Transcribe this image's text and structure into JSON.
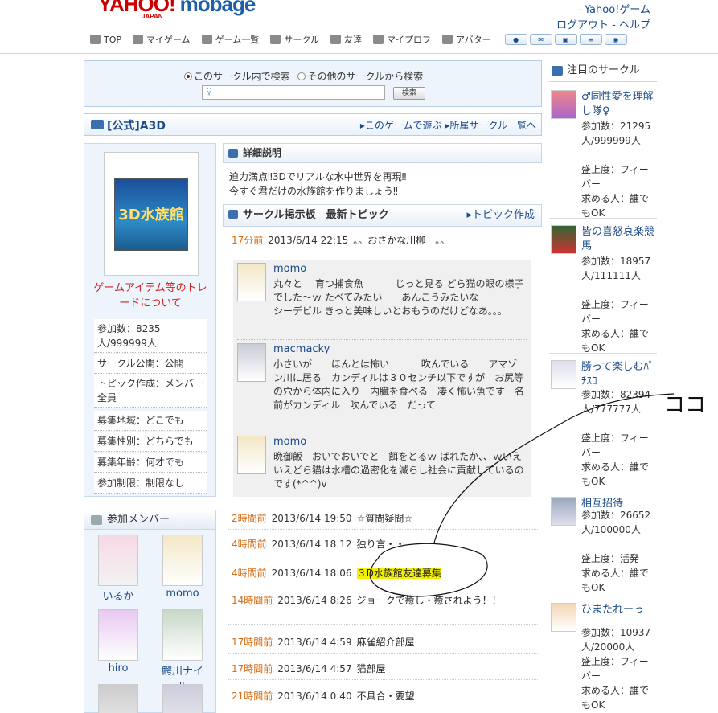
{
  "header": {
    "logo_yahoo": "YAHOO!",
    "logo_japan": "JAPAN",
    "logo_mobage": "mobage",
    "right_links": [
      "- Yahoo!ゲーム",
      "ログアウト - ヘルプ"
    ],
    "nav": [
      {
        "label": "TOP",
        "icon": "home-icon"
      },
      {
        "label": "マイゲーム",
        "icon": "mygame-icon"
      },
      {
        "label": "ゲーム一覧",
        "icon": "gamepad-icon"
      },
      {
        "label": "サークル",
        "icon": "circle-icon"
      },
      {
        "label": "友達",
        "icon": "friends-icon"
      },
      {
        "label": "マイプロフ",
        "icon": "profile-icon"
      },
      {
        "label": "アバター",
        "icon": "avatar-icon"
      }
    ],
    "mini_buttons": [
      "chat-icon",
      "mail-icon",
      "box-icon",
      "list-icon",
      "game-icon"
    ]
  },
  "search": {
    "option_this": "このサークル内で検索",
    "option_other": "その他のサークルから検索",
    "button": "検索",
    "placeholder": ""
  },
  "circle": {
    "title": "[公式]A3D",
    "link_play": "このゲームで遊ぶ",
    "link_list": "所属サークル一覧へ",
    "game_image_text": "3D水族館",
    "trade_link": "ゲームアイテム等のトレードについて",
    "info": [
      "参加数：8235人/999999人",
      "サークル公開：公開",
      "トピック作成：メンバー全員",
      "募集地域：どこでも",
      "募集性別：どちらでも",
      "募集年齢：何才でも",
      "参加制限：制限なし"
    ]
  },
  "members": {
    "header": "参加メンバー",
    "list": [
      "いるか",
      "momo",
      "hiro",
      "鰐川ナイル"
    ]
  },
  "detail": {
    "header": "詳細説明",
    "line1": "迫力満点‼3Dでリアルな水中世界を再現‼",
    "line2": "今すぐ君だけの水族館を作りましょう‼"
  },
  "board": {
    "header": "サークル掲示板　最新トピック",
    "create_link": "トピック作成",
    "latest": {
      "ago": "17分前",
      "date": "2013/6/14 22:15",
      "title": "。。おさかな川柳　。。"
    },
    "comments": [
      {
        "name": "momo",
        "text": "丸々と　 育つ捕食魚　　　 じっと見る どら猫の眼の様子でした〜ｗ たべてみたい　　あんこうみたいな　　　　　　　　シーデビル きっと美味しいとおもうのだけどなあ。。。"
      },
      {
        "name": "macmacky",
        "text": "小さいが　　ほんとは怖い　　　 吹んでいる　　アマゾン川に居る　カンディルは３０センチ以下ですが　お尻等の穴から体内に入り　内臓を食べる　凄く怖い魚です　名前がカンディル　吹んでいる　だって"
      },
      {
        "name": "momo",
        "text": "晩御飯　おいでおいでと　餌をとるｗ ばれたか、、ｗいえいえどら猫は水槽の過密化を減らし社会に貢献しているのです(*^^)v"
      }
    ],
    "topics": [
      {
        "ago": "2時間前",
        "date": "2013/6/14 19:50",
        "title": "☆質問疑問☆"
      },
      {
        "ago": "4時間前",
        "date": "2013/6/14 18:12",
        "title": "独り言・・"
      },
      {
        "ago": "4時間前",
        "date": "2013/6/14 18:06",
        "title": "３D水族館友達募集"
      },
      {
        "ago": "14時間前",
        "date": "2013/6/14 8:26",
        "title": "ジョークで癒し・癒されよう！！"
      },
      {
        "ago": "17時間前",
        "date": "2013/6/14 4:59",
        "title": "麻雀紹介部屋"
      },
      {
        "ago": "17時間前",
        "date": "2013/6/14 4:57",
        "title": "猫部屋"
      },
      {
        "ago": "21時間前",
        "date": "2013/6/14 0:40",
        "title": "不具合・要望"
      }
    ]
  },
  "featured": {
    "header": "注目のサークル",
    "items": [
      {
        "name": "♂同性愛を理解し隊♀",
        "count": "参加数：21295人/999999人",
        "mood": "盛上度：フィーバー",
        "want": "求める人：誰でもOK"
      },
      {
        "name": "皆の喜怒哀楽競馬",
        "count": "参加数：18957人/111111人",
        "mood": "盛上度：フィーバー",
        "want": "求める人：誰でもOK"
      },
      {
        "name": "勝って楽しむﾊﾟﾁｽﾛ",
        "count": "参加数：82394人/777777人",
        "mood": "盛上度：フィーバー",
        "want": "求める人：誰でもOK"
      },
      {
        "name": "相互招待",
        "count": "参加数：26652人/100000人",
        "mood": "盛上度：活発",
        "want": "求める人：誰でもOK"
      },
      {
        "name": "ひまたれーっ",
        "count": "参加数：10937人/20000人",
        "mood": "盛上度：フィーバー",
        "want": "求める人：誰でもOK"
      }
    ]
  },
  "annotation": {
    "scribble_text": "ココ"
  },
  "colors": {
    "accent": "#1a4a8a",
    "time": "#d86a10",
    "trade": "#d02020",
    "highlight": "#f2f000"
  }
}
